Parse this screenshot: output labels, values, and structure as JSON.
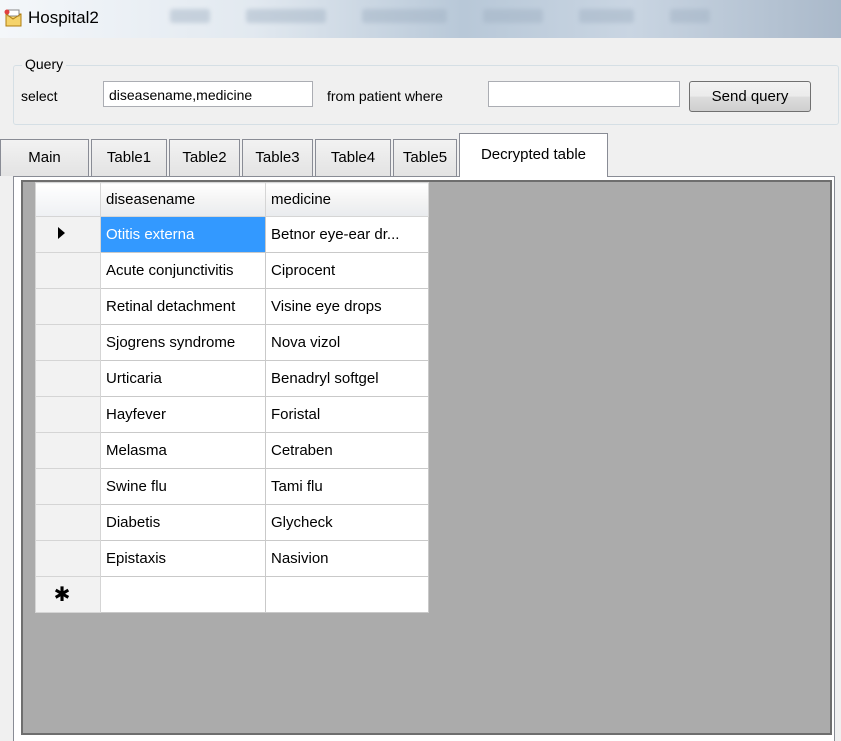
{
  "window": {
    "title": "Hospital2"
  },
  "query": {
    "group_label": "Query",
    "select_label": "select",
    "select_value": "diseasename,medicine",
    "from_label": "from patient where",
    "where_value": "",
    "send_button": "Send query"
  },
  "tabs": [
    {
      "label": "Main"
    },
    {
      "label": "Table1"
    },
    {
      "label": "Table2"
    },
    {
      "label": "Table3"
    },
    {
      "label": "Table4"
    },
    {
      "label": "Table5"
    },
    {
      "label": "Decrypted table",
      "active": true
    }
  ],
  "grid": {
    "columns": [
      "diseasename",
      "medicine"
    ],
    "rows": [
      [
        "Otitis externa",
        "Betnor eye-ear dr..."
      ],
      [
        "Acute conjunctivitis",
        "Ciprocent"
      ],
      [
        "Retinal detachment",
        "Visine eye drops"
      ],
      [
        "Sjogrens syndrome",
        "Nova vizol"
      ],
      [
        "Urticaria",
        "Benadryl softgel"
      ],
      [
        "Hayfever",
        "Foristal"
      ],
      [
        "Melasma",
        "Cetraben"
      ],
      [
        "Swine flu",
        "Tami flu"
      ],
      [
        "Diabetis",
        "Glycheck"
      ],
      [
        "Epistaxis",
        "Nasivion"
      ]
    ],
    "selected_row": 0,
    "new_row_glyph": "✱",
    "colors": {
      "selection": "#3399ff",
      "grid_background": "#ababab"
    }
  }
}
